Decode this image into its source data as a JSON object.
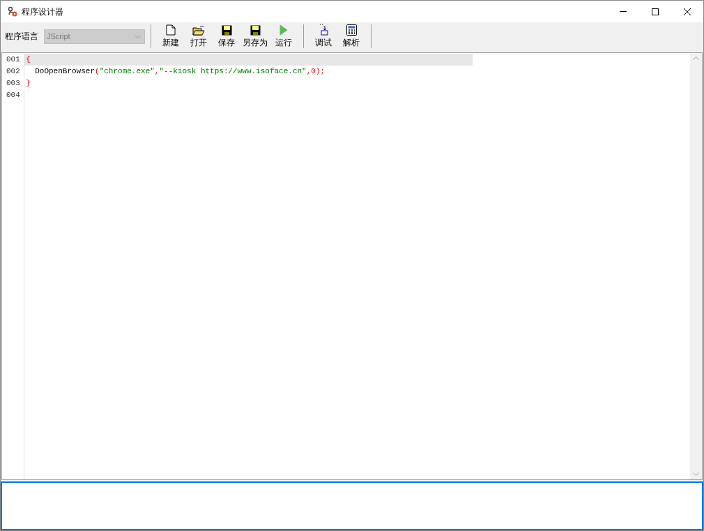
{
  "window": {
    "title": "程序设计器"
  },
  "toolbar": {
    "language_label": "程序语言",
    "language_select": {
      "value": "JScript",
      "disabled": true
    },
    "groups": [
      [
        {
          "label": "新建"
        },
        {
          "label": "打开"
        },
        {
          "label": "保存"
        },
        {
          "label": "另存为"
        },
        {
          "label": "运行"
        }
      ],
      [
        {
          "label": "调试"
        },
        {
          "label": "解析"
        }
      ]
    ]
  },
  "editor": {
    "lines": [
      {
        "number": "001",
        "current": true,
        "tokens": [
          {
            "kind": "punct",
            "text": "{"
          }
        ]
      },
      {
        "number": "002",
        "current": false,
        "tokens": [
          {
            "kind": "plain",
            "text": "  DoOpenBrowser"
          },
          {
            "kind": "punct",
            "text": "("
          },
          {
            "kind": "string",
            "text": "\"chrome.exe\""
          },
          {
            "kind": "punct",
            "text": ","
          },
          {
            "kind": "string",
            "text": "\"--kiosk https://www.isoface.cn\""
          },
          {
            "kind": "punct",
            "text": ","
          },
          {
            "kind": "number",
            "text": "0"
          },
          {
            "kind": "punct",
            "text": ");"
          }
        ]
      },
      {
        "number": "003",
        "current": false,
        "tokens": [
          {
            "kind": "punct",
            "text": "}"
          }
        ]
      },
      {
        "number": "004",
        "current": false
      }
    ]
  }
}
